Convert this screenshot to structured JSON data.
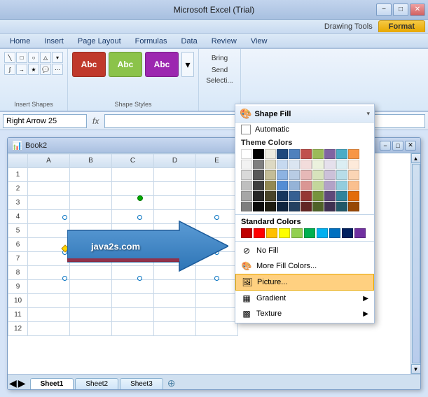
{
  "titlebar": {
    "title": "Microsoft Excel (Trial)",
    "minimize": "−",
    "maximize": "□",
    "close": "✕"
  },
  "drawing_tools": {
    "label": "Drawing Tools",
    "format_tab": "Format"
  },
  "ribbon_tabs": [
    "Home",
    "Insert",
    "Page Layout",
    "Formulas",
    "Data",
    "Review",
    "View",
    "Format"
  ],
  "sections": {
    "insert_shapes": "Insert Shapes",
    "shape_styles": "Shape Styles"
  },
  "formula_bar": {
    "name_box": "Right Arrow 25",
    "formula_icon": "fx"
  },
  "sheet": {
    "title": "Book2",
    "columns": [
      "A",
      "B",
      "C",
      "D"
    ],
    "rows": [
      "1",
      "2",
      "3",
      "4",
      "5",
      "6",
      "7",
      "8",
      "9",
      "10",
      "11",
      "12"
    ],
    "tabs": [
      "Sheet1",
      "Sheet2",
      "Sheet3"
    ]
  },
  "shape": {
    "label": "java2s.com"
  },
  "dropdown": {
    "header": "Shape Fill",
    "automatic_label": "Automatic",
    "theme_colors_label": "Theme Colors",
    "standard_colors_label": "Standard Colors",
    "no_fill": "No Fill",
    "more_colors": "More Fill Colors...",
    "picture": "Picture...",
    "gradient": "Gradient",
    "texture": "Texture"
  },
  "theme_colors": [
    [
      "#FFFFFF",
      "#000000",
      "#EEECE1",
      "#1F497D",
      "#4F81BD",
      "#C0504D",
      "#9BBB59",
      "#8064A2",
      "#4BACC6",
      "#F79646"
    ],
    [
      "#F2F2F2",
      "#7F7F7F",
      "#DDD9C3",
      "#C6D9F0",
      "#DBE5F1",
      "#F2DCDB",
      "#EBF1DD",
      "#E5E0EC",
      "#DBEEF3",
      "#FDEADA"
    ],
    [
      "#D9D9D9",
      "#595959",
      "#C4BD97",
      "#8DB3E2",
      "#B8CCE4",
      "#E6B8B7",
      "#D7E3BC",
      "#CCC1D9",
      "#B7DDE8",
      "#FBD5B5"
    ],
    [
      "#BFBFBF",
      "#3F3F3F",
      "#938953",
      "#548DD4",
      "#95B3D7",
      "#DA9694",
      "#C3D69B",
      "#B2A2C7",
      "#93CDDD",
      "#FAC08F"
    ],
    [
      "#A6A6A6",
      "#262626",
      "#494429",
      "#17375E",
      "#366092",
      "#953734",
      "#76933C",
      "#5F497A",
      "#31849B",
      "#E36C09"
    ],
    [
      "#7F7F7F",
      "#0C0C0C",
      "#1D1B10",
      "#0F243E",
      "#244061",
      "#632523",
      "#4F6228",
      "#3F3151",
      "#215868",
      "#974806"
    ]
  ],
  "standard_colors": [
    "#C00000",
    "#FF0000",
    "#FFC000",
    "#FFFF00",
    "#92D050",
    "#00B050",
    "#00B0F0",
    "#0070C0",
    "#002060",
    "#7030A0"
  ],
  "style_samples": [
    {
      "color": "#c0392b",
      "label": "Abc"
    },
    {
      "color": "#8bc34a",
      "label": "Abc"
    },
    {
      "color": "#9c27b0",
      "label": "Abc"
    }
  ]
}
